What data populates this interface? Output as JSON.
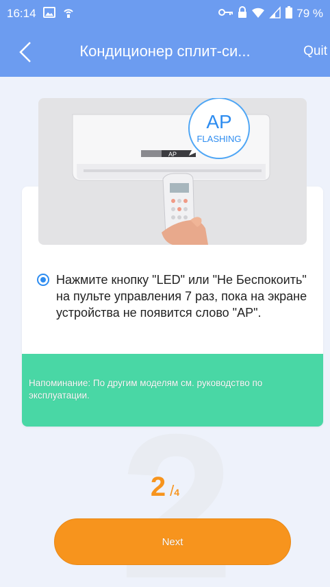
{
  "status_bar": {
    "time": "16:14",
    "battery": "79 %"
  },
  "header": {
    "title": "Кондиционер сплит-си...",
    "quit_label": "Quit"
  },
  "illustration": {
    "bubble_main": "AP",
    "bubble_sub": "FLASHING",
    "display_text": "AP"
  },
  "instruction": {
    "text": "Нажмите кнопку \"LED\" или \"Не Беспокоить\" на пульте управления 7 раз, пока на экране устройства не появится слово \"AP\"."
  },
  "reminder": {
    "text": "Напоминание: По другим моделям см. руководство по эксплуатации."
  },
  "step": {
    "current": "2",
    "separator": "/",
    "total": "4",
    "background_digit": "2"
  },
  "next_button": {
    "label": "Next"
  },
  "colors": {
    "header": "#6c9cf0",
    "accent": "#f7941d",
    "reminder": "#49d7a5",
    "radio": "#2d8cf0"
  }
}
